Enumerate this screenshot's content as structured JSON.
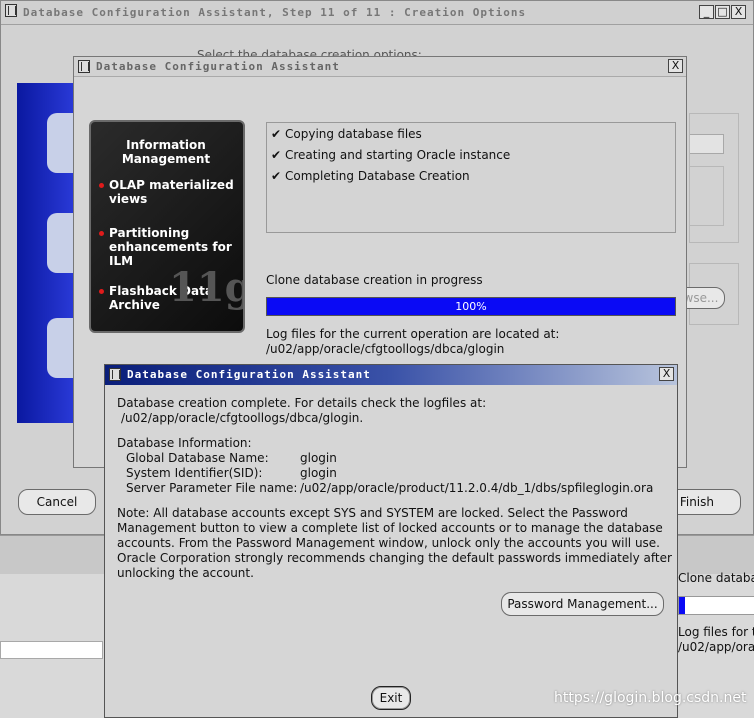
{
  "main_window": {
    "title": "Database Configuration Assistant, Step 11 of 11 : Creation Options",
    "minimize": "_",
    "maximize": "□",
    "close": "X",
    "subtitle_partial": "Select the database creation options:",
    "cancel_label": "Cancel",
    "finish_label": "Finish",
    "browse_partial": "wse..."
  },
  "progress_dialog": {
    "title": "Database Configuration Assistant",
    "close": "X",
    "promo": {
      "heading": "Information Management",
      "items": [
        "OLAP materialized views",
        "Partitioning enhancements for ILM",
        "Flashback Data Archive"
      ],
      "version_badge": "11g"
    },
    "check_mark": "✔",
    "tasks": [
      "Copying database files",
      "Creating and starting Oracle instance",
      "Completing Database Creation"
    ],
    "status": "Clone database creation in progress",
    "progress_percent": 100,
    "progress_label": "100%",
    "log_label": "Log files for the current operation are located at:",
    "log_path": "/u02/app/oracle/cfgtoollogs/dbca/glogin"
  },
  "complete_dialog": {
    "title": "Database Configuration Assistant",
    "close": "X",
    "line1": "Database creation complete. For details check the logfiles at:",
    "line2": "/u02/app/oracle/cfgtoollogs/dbca/glogin.",
    "info_heading": "Database Information:",
    "info": [
      {
        "label": "Global Database Name:",
        "value": "glogin"
      },
      {
        "label": "System Identifier(SID):",
        "value": "glogin"
      },
      {
        "label": "Server Parameter File name:",
        "value": "/u02/app/oracle/product/11.2.0.4/db_1/dbs/spfileglogin.ora"
      }
    ],
    "note_lines": [
      "Note: All database accounts except SYS and SYSTEM are locked. Select the Password",
      "Management button to view a complete list of locked accounts or to manage the database",
      "accounts. From the Password Management window, unlock only the accounts you will use.",
      "Oracle Corporation strongly recommends changing the default passwords immediately after",
      "unlocking the account."
    ],
    "password_button": "Password Management...",
    "exit_button": "Exit"
  },
  "background_window": {
    "clone_text": "Clone databa",
    "log_text": "Log files for th",
    "path_text": "/u02/app/ora"
  },
  "watermark": "https://glogin.blog.csdn.net",
  "colors": {
    "titlebar_inactive": "#d0d0d0",
    "titlebar_active_start": "#0a1e7a",
    "titlebar_active_end": "#b8c4dc",
    "progress": "#0a0af5"
  }
}
